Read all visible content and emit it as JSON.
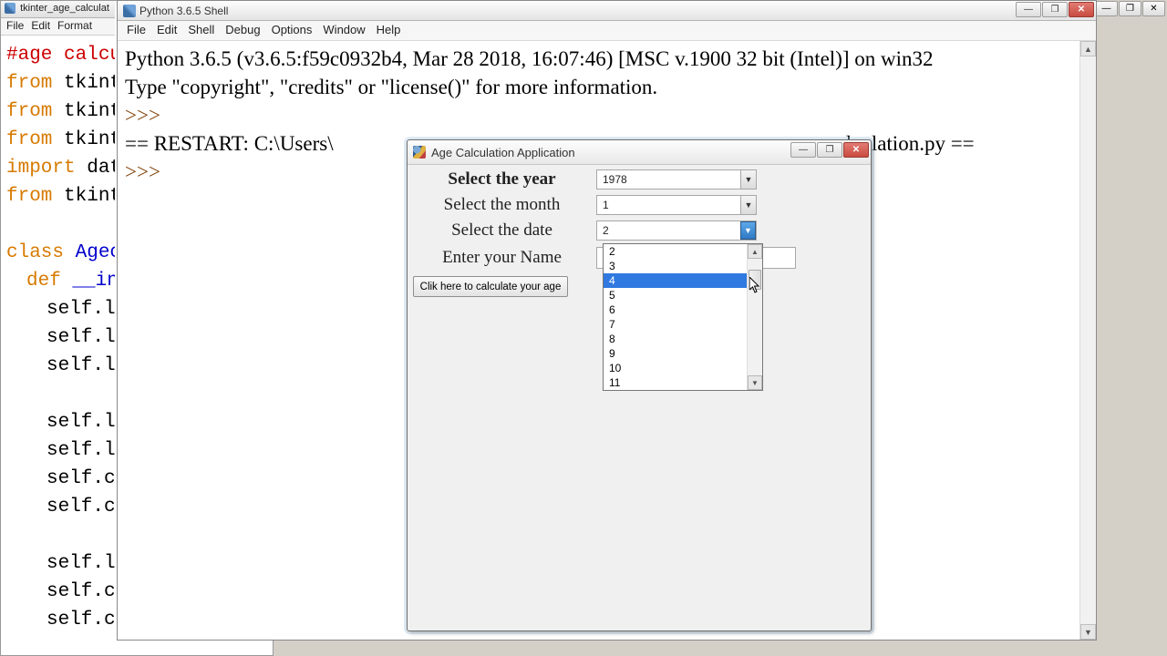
{
  "editor": {
    "title": "tkinter_age_calculat",
    "menu": [
      "File",
      "Edit",
      "Format"
    ],
    "code": {
      "l1": "#age calcu",
      "l2a": "from",
      "l2b": " tkint",
      "l3a": "from",
      "l3b": " tkint",
      "l4a": "from",
      "l4b": " tkint",
      "l5a": "import",
      "l5b": " dat",
      "l6a": "from",
      "l6b": " tkint",
      "l7a": "class",
      "l7b": " Agec",
      "l8a": "def",
      "l8b": " __in",
      "l9": "self.la",
      "l10": "self.la",
      "l11": "self.la",
      "l12": "self.la",
      "l13": "self.la",
      "l14": "self.c",
      "l15": "self.c",
      "l16": "self.la",
      "l17": "self.c",
      "l18": "self.c"
    }
  },
  "shell": {
    "title": "Python 3.6.5 Shell",
    "menu": [
      "File",
      "Edit",
      "Shell",
      "Debug",
      "Options",
      "Window",
      "Help"
    ],
    "banner_line1": "Python 3.6.5 (v3.6.5:f59c0932b4, Mar 28 2018, 16:07:46) [MSC v.1900 32 bit (Intel)] on win32",
    "banner_line2": "Type \"copyright\", \"credits\" or \"license()\" for more information.",
    "prompt": ">>>",
    "restart_line_a": "== RESTART: C:\\Users\\",
    "restart_line_b": "e_calculation.py ==",
    "prompt2": ">>>"
  },
  "tk": {
    "title": "Age Calculation Application",
    "labels": {
      "year": "Select the year",
      "month": "Select the month",
      "date": "Select the date",
      "name": "Enter your Name"
    },
    "values": {
      "year": "1978",
      "month": "1",
      "date": "2",
      "name": ""
    },
    "dropdown_options": [
      "2",
      "3",
      "4",
      "5",
      "6",
      "7",
      "8",
      "9",
      "10",
      "11"
    ],
    "dropdown_highlight_index": 2,
    "calc_button": "Clik here to calculate your age"
  },
  "win_buttons": {
    "min": "—",
    "max": "❐",
    "close": "✕"
  }
}
